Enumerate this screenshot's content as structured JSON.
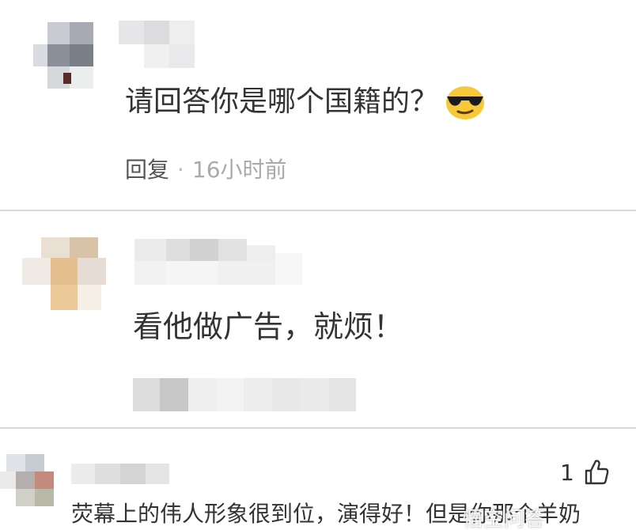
{
  "comments": [
    {
      "text": "请回答你是哪个国籍的？",
      "emoji": "sunglasses-emoji",
      "reply_label": "回复",
      "separator": "·",
      "time": "16小时前"
    },
    {
      "text": "看他做广告，就烦！"
    },
    {
      "text": "荧幕上的伟人形象很到位，演得好！但是你那个羊奶",
      "likes": "1",
      "like_icon": "thumbs-up-icon"
    }
  ],
  "watermark": "悟空问答"
}
